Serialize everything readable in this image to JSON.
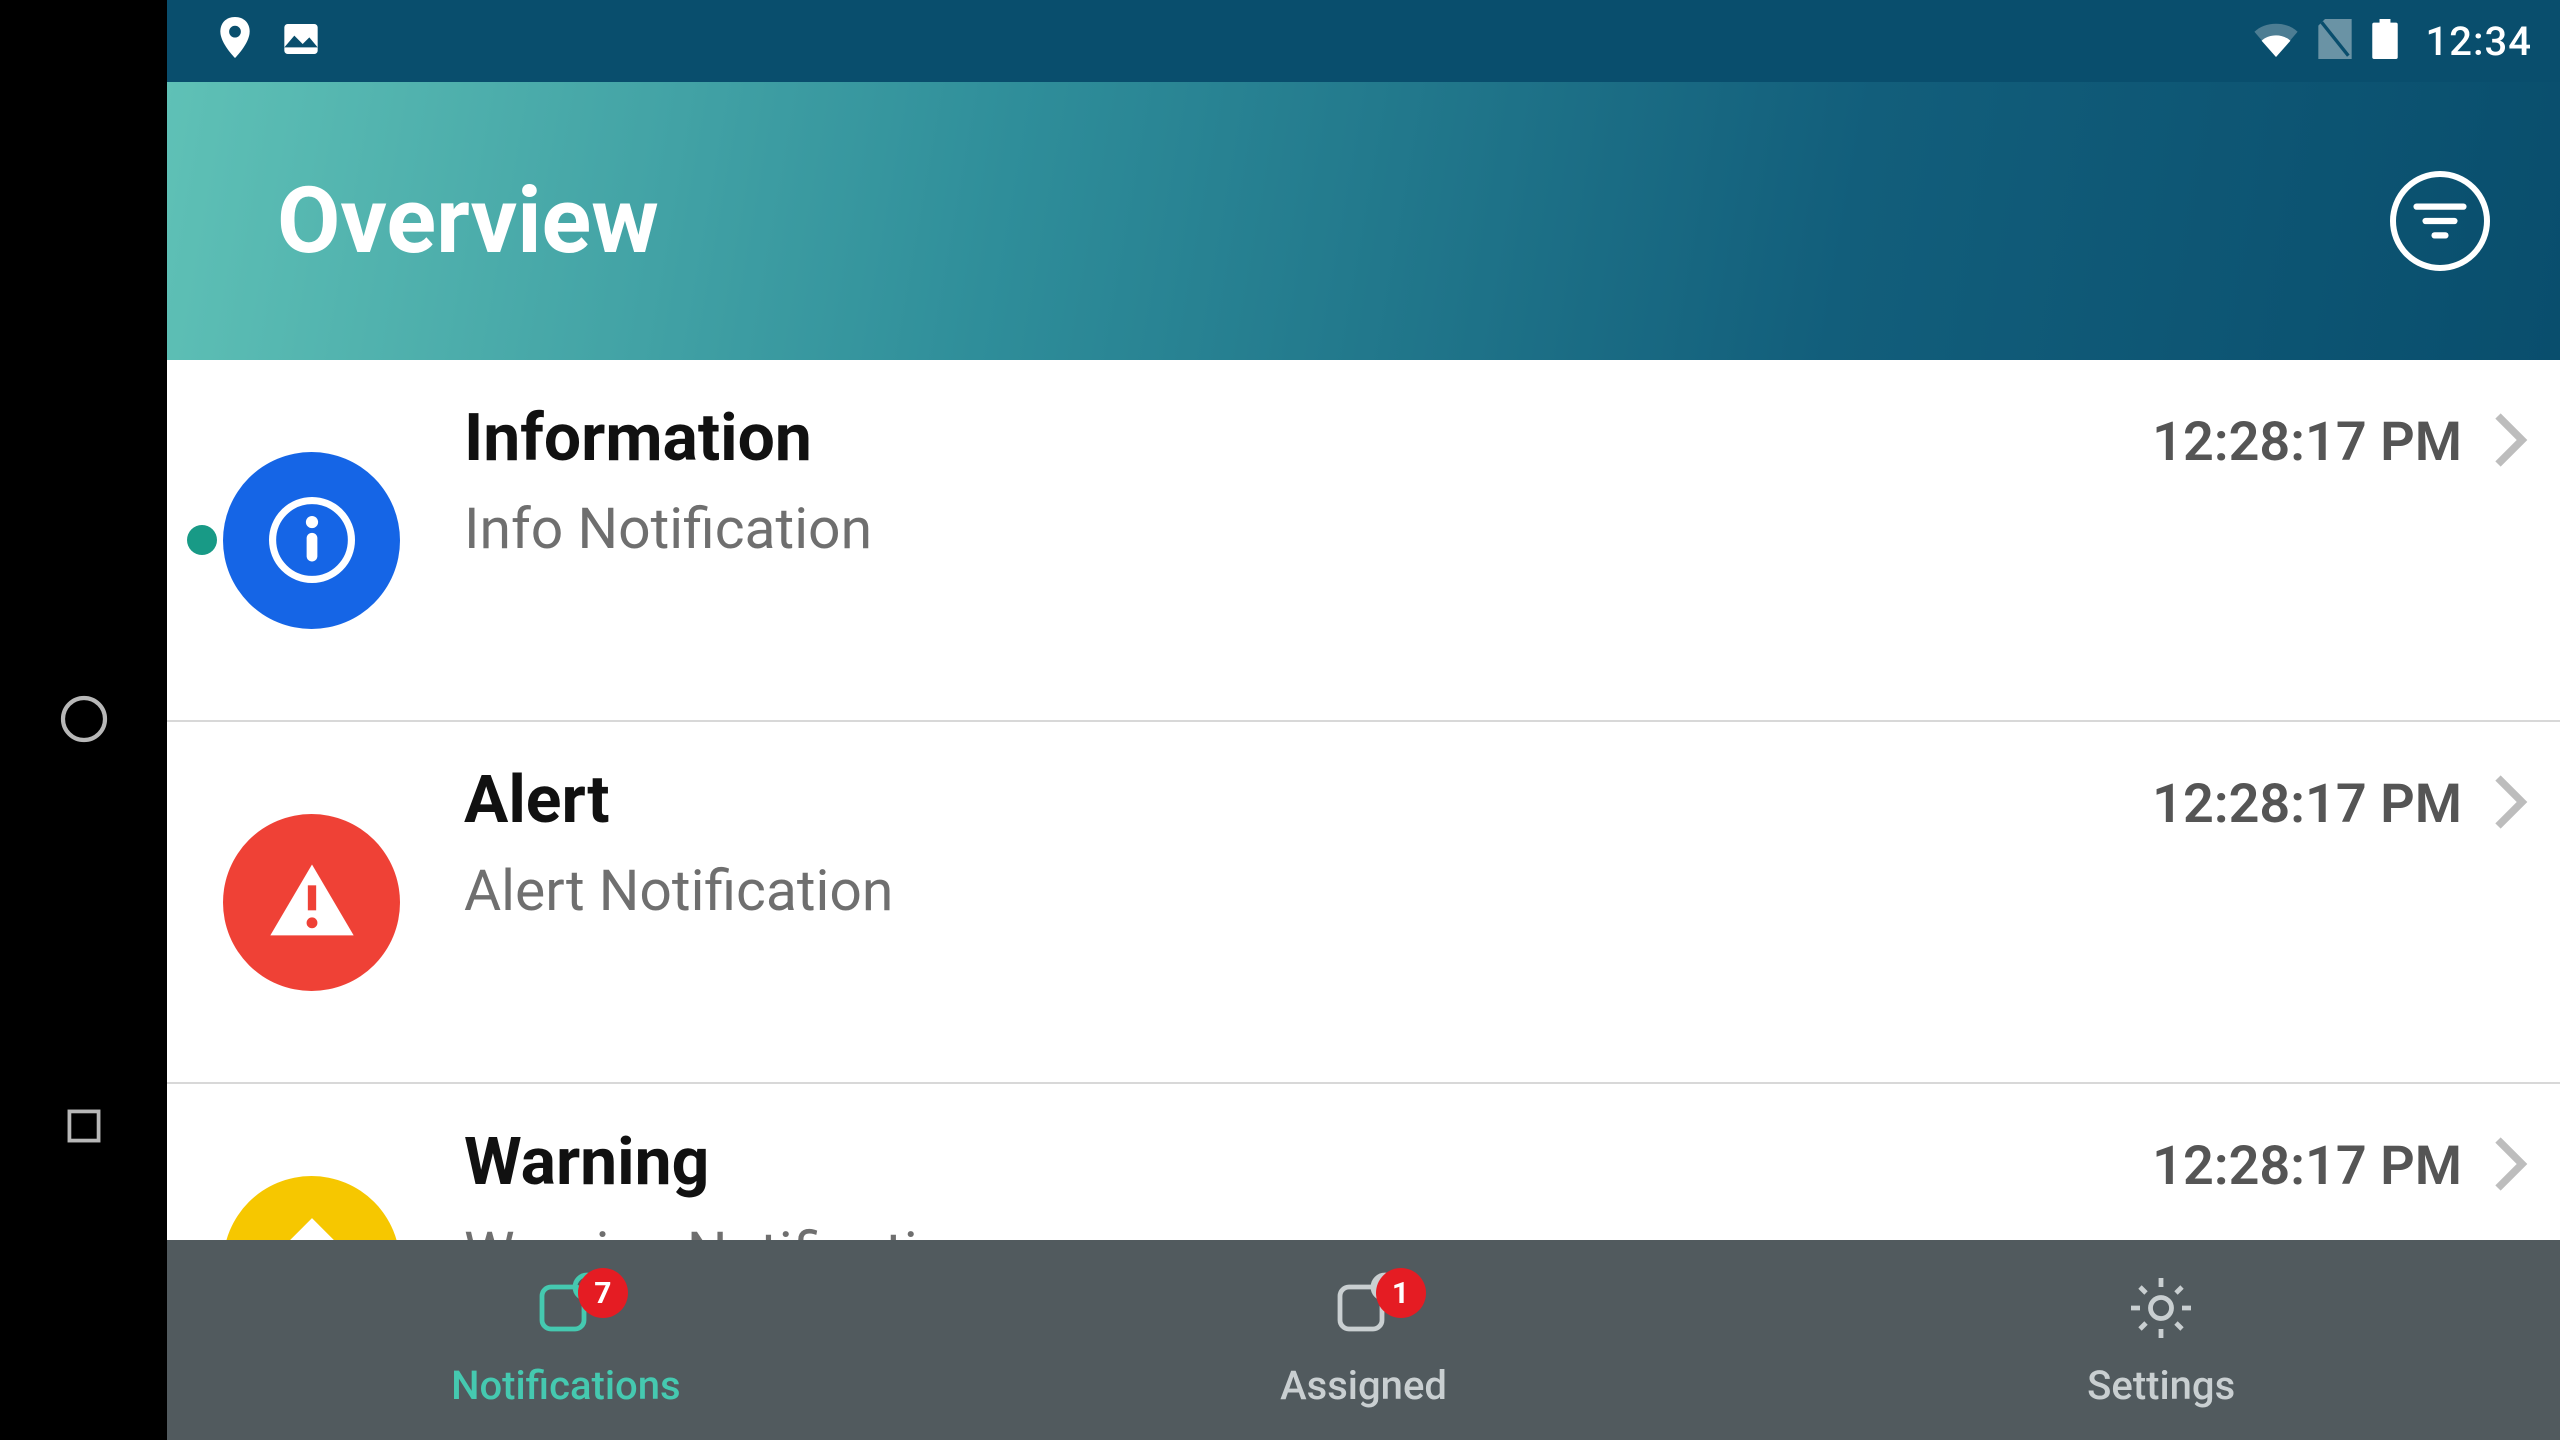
{
  "statusbar": {
    "time": "12:34"
  },
  "header": {
    "title": "Overview"
  },
  "notifications": [
    {
      "title": "Information",
      "subtitle": "Info Notification",
      "time": "12:28:17 PM",
      "unread": true,
      "kind": "info"
    },
    {
      "title": "Alert",
      "subtitle": "Alert Notification",
      "time": "12:28:17 PM",
      "unread": false,
      "kind": "alert"
    },
    {
      "title": "Warning",
      "subtitle": "Warning Notification",
      "time": "12:28:17 PM",
      "unread": true,
      "kind": "warn"
    }
  ],
  "tabs": {
    "notifications": {
      "label": "Notifications",
      "badge": "7"
    },
    "assigned": {
      "label": "Assigned",
      "badge": "1"
    },
    "settings": {
      "label": "Settings"
    }
  },
  "colors": {
    "info": "#1565e6",
    "alert": "#ef4136",
    "warn": "#f6c700"
  }
}
